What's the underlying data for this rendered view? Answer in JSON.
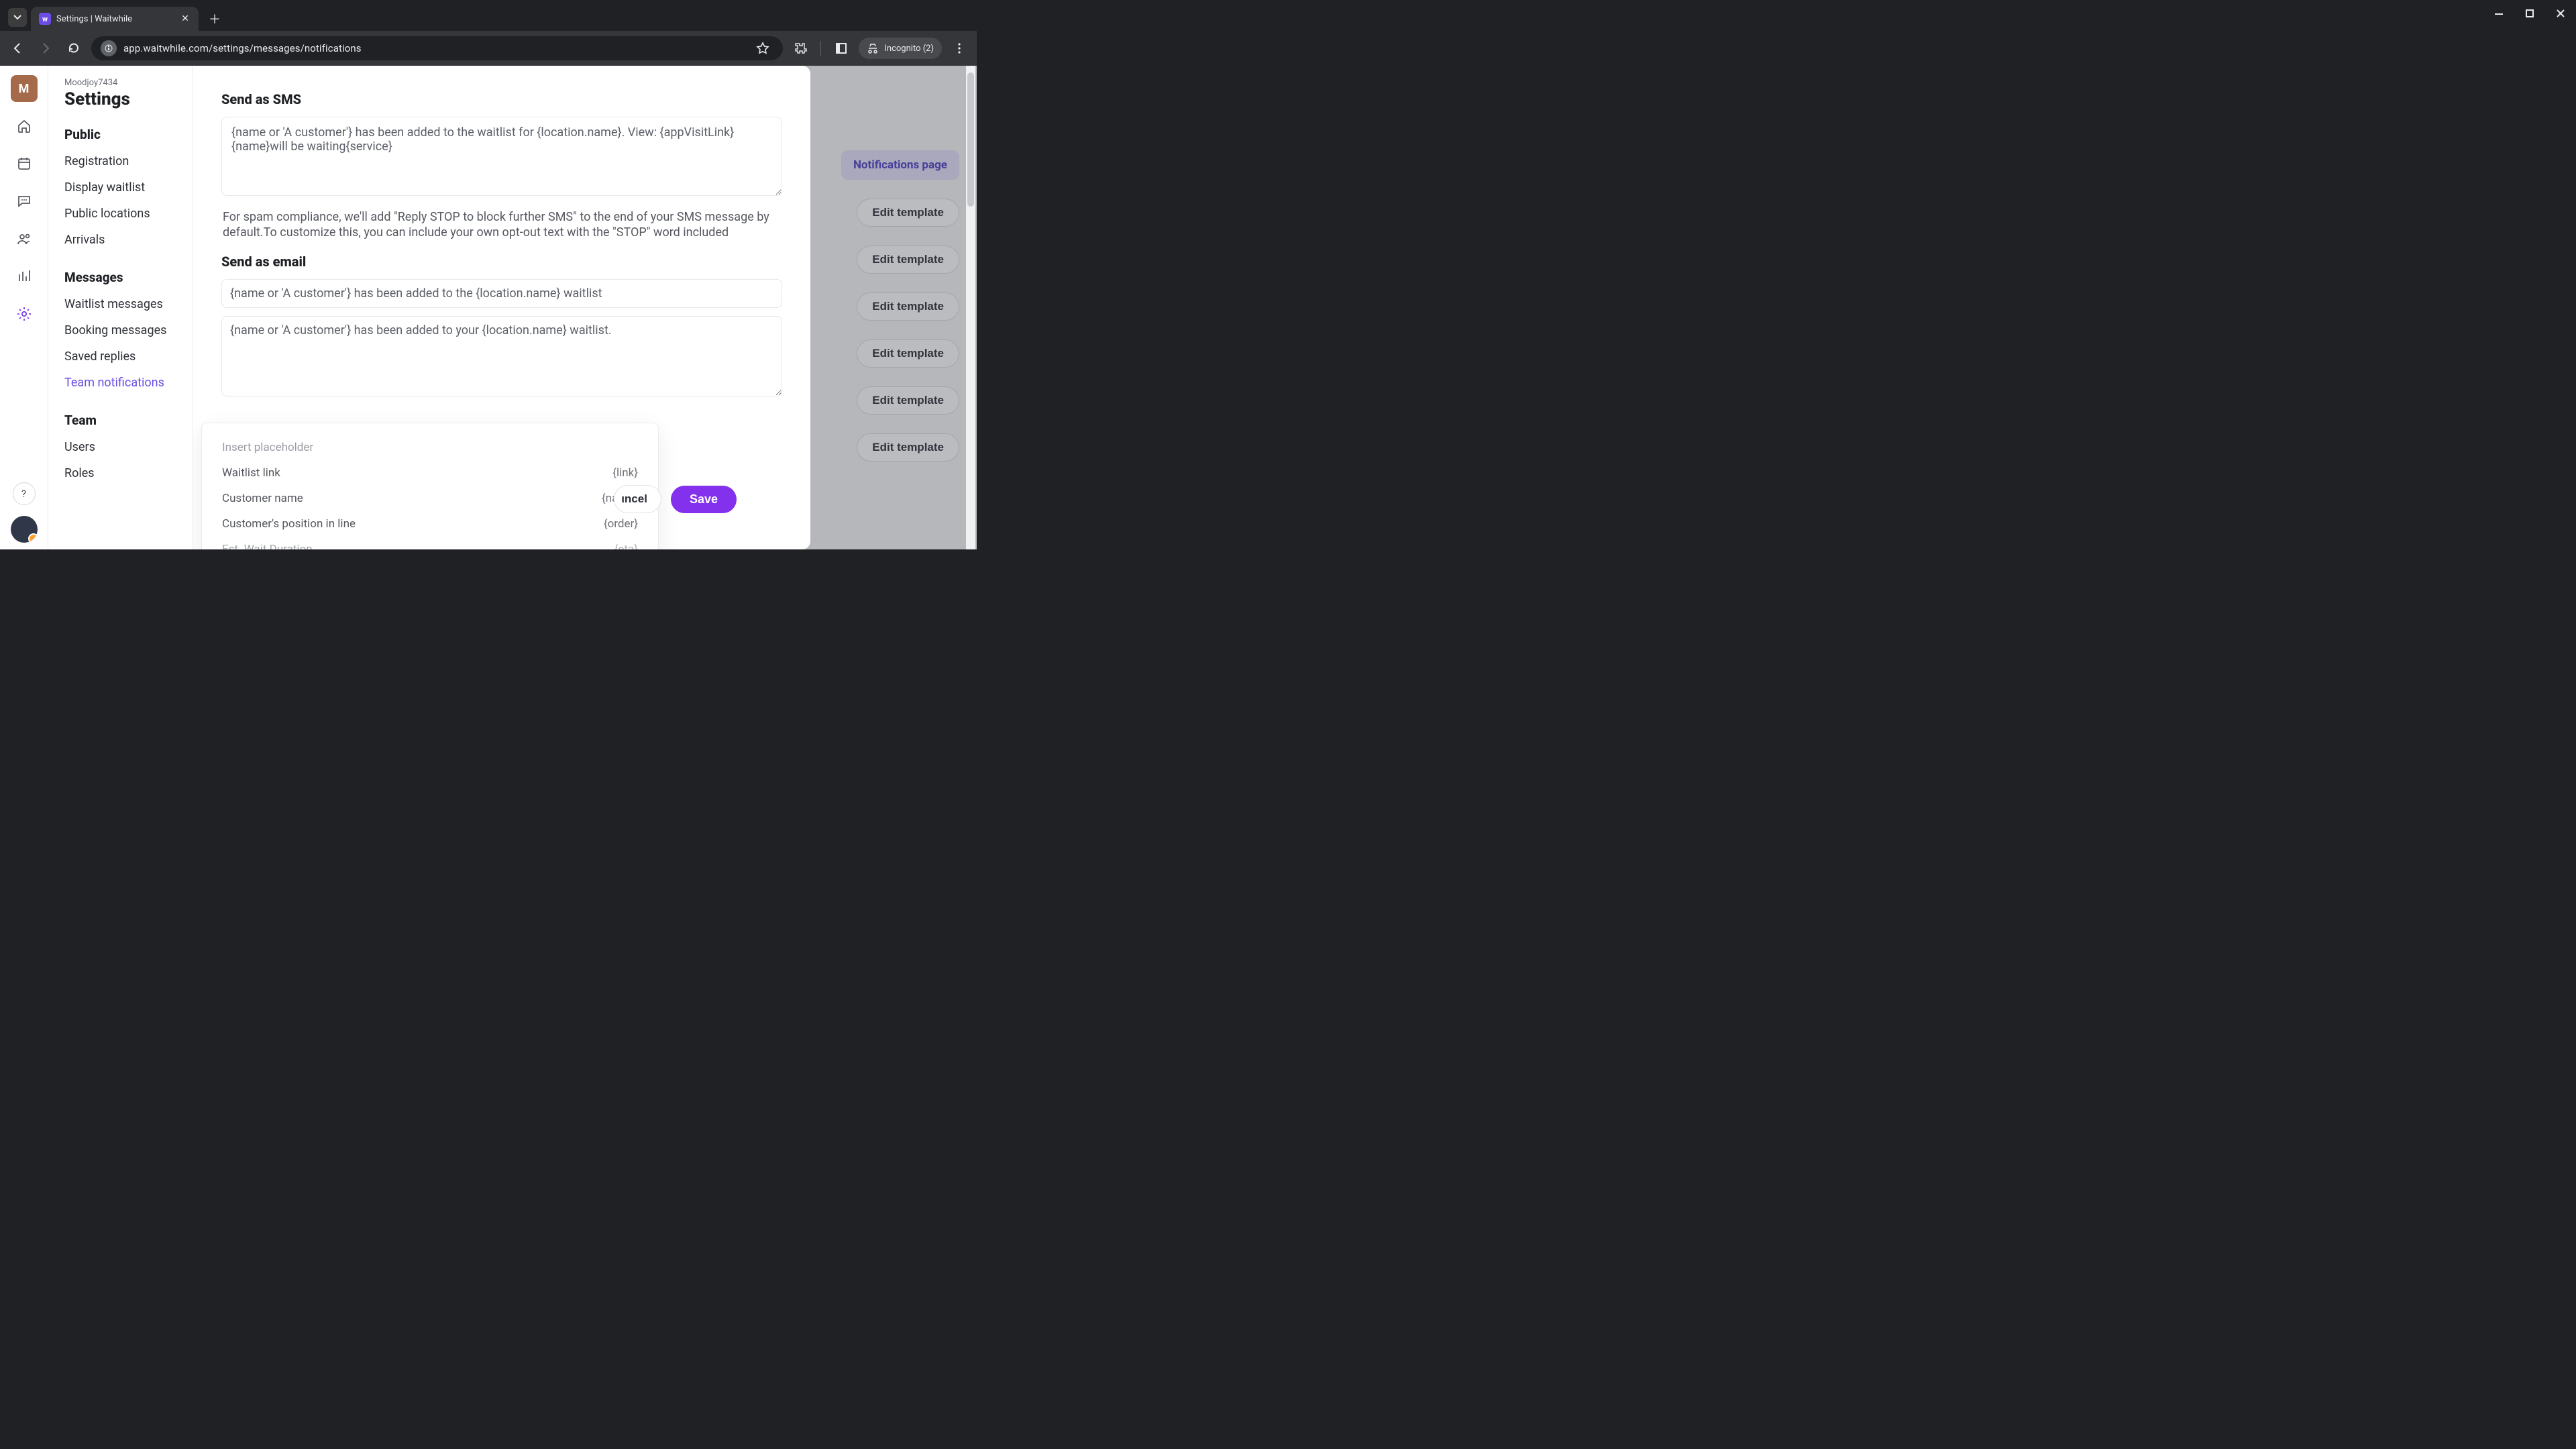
{
  "browser": {
    "tab_title": "Settings | Waitwhile",
    "url": "app.waitwhile.com/settings/messages/notifications",
    "incognito_label": "Incognito (2)"
  },
  "org": {
    "name": "Moodjoy7434",
    "page_title": "Settings"
  },
  "sidebar": {
    "groups": [
      {
        "head": "Public",
        "items": [
          "Registration",
          "Display waitlist",
          "Public locations",
          "Arrivals"
        ]
      },
      {
        "head": "Messages",
        "items": [
          "Waitlist messages",
          "Booking messages",
          "Saved replies",
          "Team notifications"
        ],
        "active_index": 3
      },
      {
        "head": "Team",
        "items": [
          "Users",
          "Roles"
        ]
      }
    ]
  },
  "background": {
    "notifications_page_label": "Notifications page",
    "edit_template_label": "Edit template",
    "edit_template_count": 6
  },
  "modal": {
    "sms": {
      "title": "Send as SMS",
      "value": "{name or 'A customer'} has been added to the waitlist for {location.name}. View: {appVisitLink}{name}will be waiting{service}",
      "compliance_note": "For spam compliance, we'll add \"Reply STOP to block further SMS\" to the end of your SMS message by default.To customize this, you can include your own opt-out text with the \"STOP\" word included"
    },
    "email": {
      "title": "Send as email",
      "subject": "{name or 'A customer'} has been added to the {location.name} waitlist",
      "body": "{name or 'A customer'} has been added to your {location.name} waitlist."
    },
    "insert_label": "Insert placeholder",
    "placeholders": [
      {
        "label": "Waitlist link",
        "token": "{link}"
      },
      {
        "label": "Customer name",
        "token": "{name}"
      },
      {
        "label": "Customer's position in line",
        "token": "{order}"
      },
      {
        "label": "Est. Wait Duration",
        "token": "{eta}"
      }
    ],
    "actions": {
      "cancel": "Cancel",
      "cancel_visible": "ıncel",
      "save": "Save"
    }
  }
}
